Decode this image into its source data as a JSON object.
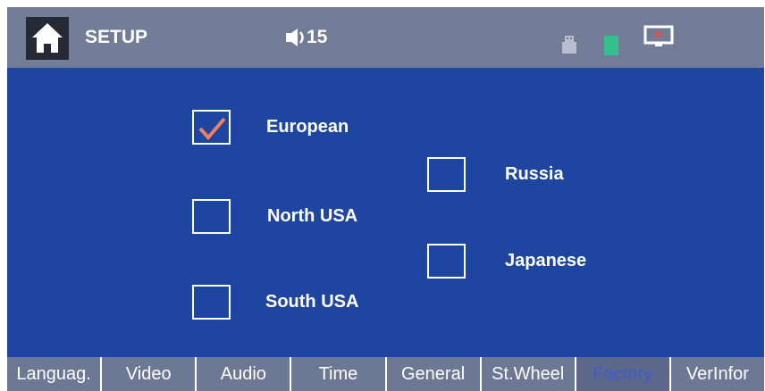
{
  "header": {
    "title": "SETUP",
    "volume_value": "15",
    "home_icon": "home-icon",
    "speaker_icon": "speaker-icon",
    "status_icons": [
      "usb-icon",
      "sd-card-icon",
      "screen-off-icon"
    ]
  },
  "options": [
    {
      "label": "European",
      "checked": true
    },
    {
      "label": "Russia",
      "checked": false
    },
    {
      "label": "North USA",
      "checked": false
    },
    {
      "label": "Japanese",
      "checked": false
    },
    {
      "label": "South USA",
      "checked": false
    }
  ],
  "tabs": [
    {
      "label": "Languag."
    },
    {
      "label": "Video"
    },
    {
      "label": "Audio"
    },
    {
      "label": "Time"
    },
    {
      "label": "General"
    },
    {
      "label": "St.Wheel"
    },
    {
      "label": "Factory",
      "active": true
    },
    {
      "label": "VerInfor"
    }
  ],
  "colors": {
    "background": "#1e46a0",
    "header": "#727c96",
    "tab": "#6d7895",
    "active_tab_text": "#3d5ccf",
    "check": "#f08060"
  }
}
